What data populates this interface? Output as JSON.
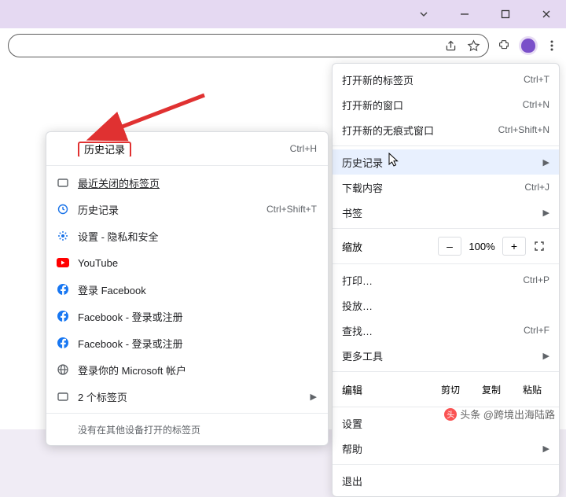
{
  "main_menu": {
    "new_tab": {
      "label": "打开新的标签页",
      "shortcut": "Ctrl+T"
    },
    "new_window": {
      "label": "打开新的窗口",
      "shortcut": "Ctrl+N"
    },
    "incognito": {
      "label": "打开新的无痕式窗口",
      "shortcut": "Ctrl+Shift+N"
    },
    "history": {
      "label": "历史记录"
    },
    "downloads": {
      "label": "下载内容",
      "shortcut": "Ctrl+J"
    },
    "bookmarks": {
      "label": "书签"
    },
    "zoom": {
      "label": "缩放",
      "value": "100%",
      "minus": "–",
      "plus": "+"
    },
    "print": {
      "label": "打印…",
      "shortcut": "Ctrl+P"
    },
    "cast": {
      "label": "投放…"
    },
    "find": {
      "label": "查找…",
      "shortcut": "Ctrl+F"
    },
    "more_tools": {
      "label": "更多工具"
    },
    "edit": {
      "label": "编辑",
      "cut": "剪切",
      "copy": "复制",
      "paste": "粘贴"
    },
    "settings": {
      "label": "设置"
    },
    "help": {
      "label": "帮助"
    },
    "exit": {
      "label": "退出"
    }
  },
  "sub_menu": {
    "header": {
      "label": "历史记录",
      "shortcut": "Ctrl+H"
    },
    "recent_closed": {
      "label": "最近关闭的标签页"
    },
    "history_item": {
      "label": "历史记录",
      "shortcut": "Ctrl+Shift+T"
    },
    "settings_privacy": {
      "label": "设置 - 隐私和安全"
    },
    "youtube": {
      "label": "YouTube"
    },
    "fb_login": {
      "label": "登录 Facebook"
    },
    "fb_signup_1": {
      "label": "Facebook - 登录或注册"
    },
    "fb_signup_2": {
      "label": "Facebook - 登录或注册"
    },
    "ms_login": {
      "label": "登录你的 Microsoft 帐户"
    },
    "two_tabs": {
      "label": "2 个标签页"
    },
    "footer": "没有在其他设备打开的标签页"
  },
  "watermark": "跨境出海陆路",
  "attribution": "头条 @跨境出海陆路"
}
